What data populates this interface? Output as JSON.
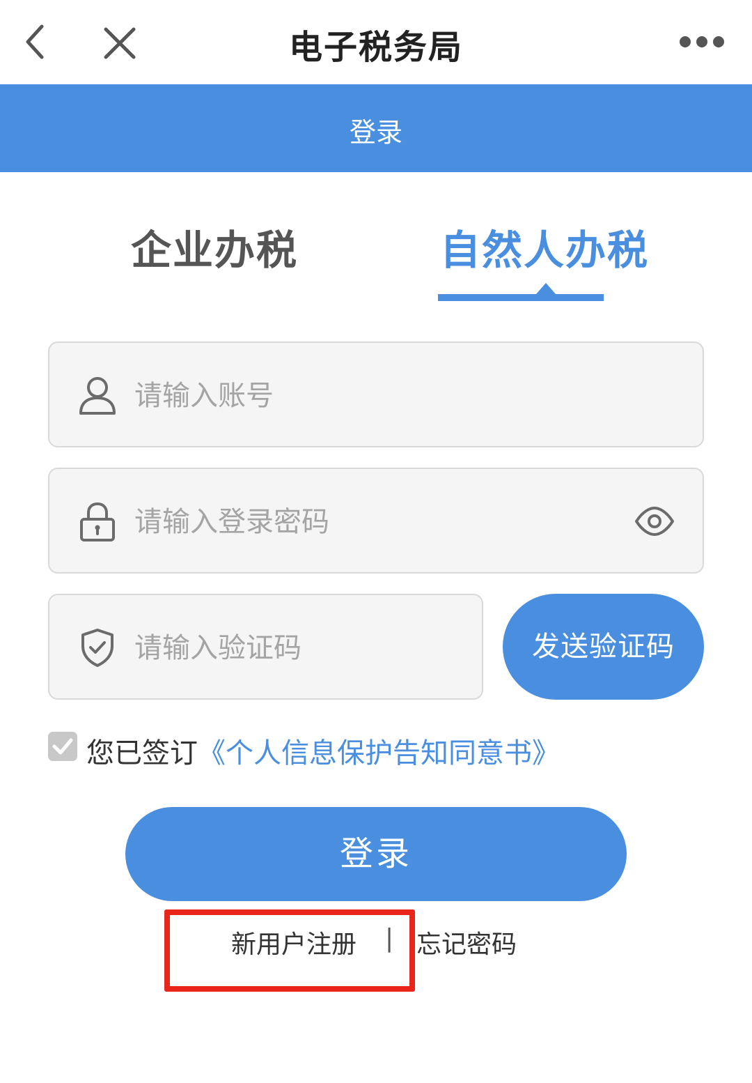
{
  "topbar": {
    "back_icon": "chevron-left-icon",
    "close_icon": "close-icon",
    "title": "电子税务局",
    "more_icon": "more-dots-icon"
  },
  "header": {
    "title": "登录",
    "background": "#4a8ee0"
  },
  "tabs": [
    {
      "label": "企业办税",
      "active": false
    },
    {
      "label": "自然人办税",
      "active": true
    }
  ],
  "form": {
    "account": {
      "placeholder": "请输入账号",
      "value": "",
      "icon": "user-icon"
    },
    "password": {
      "placeholder": "请输入登录密码",
      "value": "",
      "icon": "lock-icon",
      "toggle_icon": "eye-icon"
    },
    "code": {
      "placeholder": "请输入验证码",
      "value": "",
      "icon": "shield-check-icon"
    },
    "send_code_label": "发送验证码"
  },
  "agreement": {
    "checked": true,
    "prefix": "您已签订",
    "link": "《个人信息保护告知同意书》"
  },
  "login_button": "登录",
  "bottom_links": {
    "register": "新用户注册",
    "separator": "|",
    "forgot": "忘记密码"
  },
  "colors": {
    "accent": "#4a8ee0",
    "highlight": "#e8261c"
  }
}
